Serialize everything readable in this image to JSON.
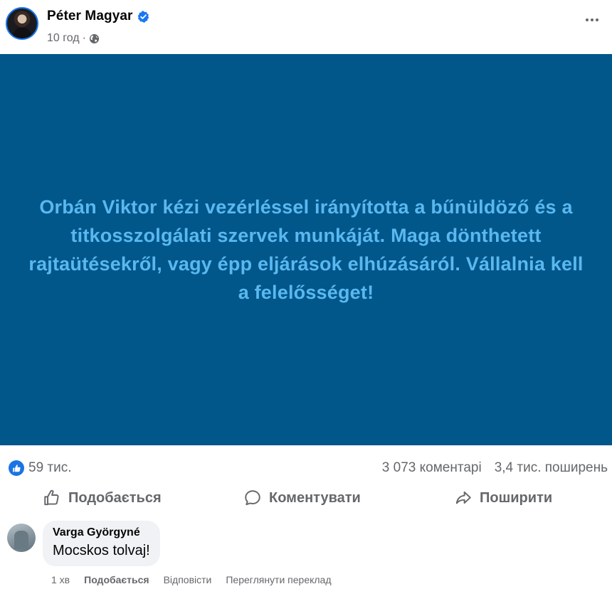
{
  "post": {
    "author": "Péter Magyar",
    "timestamp": "10 год",
    "separator": "·",
    "text": "Orbán Viktor kézi vezérléssel irányította a bűnüldöző és a titkosszolgálati szervek munkáját. Maga dönthetett rajtaütésekről, vagy épp eljárások elhúzásáról. Vállalnia kell a felelősséget!",
    "background_color": "#01568a",
    "text_color": "#5ab8f0"
  },
  "stats": {
    "reactions": "59 тис.",
    "comments": "3 073 коментарі",
    "shares": "3,4 тис. поширень"
  },
  "actions": {
    "like": "Подобається",
    "comment": "Коментувати",
    "share": "Поширити"
  },
  "comment": {
    "author": "Varga Györgyné",
    "text": "Mocskos tolvaj!",
    "time": "1 хв",
    "like": "Подобається",
    "reply": "Відповісти",
    "translate": "Переглянути переклад"
  },
  "icons": {
    "verified": "verified-badge-icon",
    "audience": "globe-icon",
    "more": "more-dots-icon",
    "reaction": "like-reaction-icon",
    "like": "thumbs-up-icon",
    "comment": "speech-bubble-icon",
    "share": "share-arrow-icon"
  },
  "colors": {
    "accent": "#1877f2",
    "secondary_text": "#65676b"
  }
}
